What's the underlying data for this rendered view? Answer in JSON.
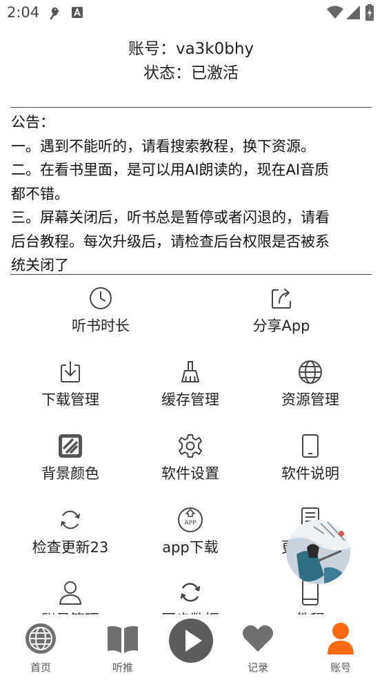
{
  "status_bar": {
    "time": "2:04"
  },
  "account": {
    "username_line": "账号：va3k0bhy",
    "status_line": "状态：已激活"
  },
  "notice": {
    "title": "公告：",
    "lines": [
      "一。遇到不能听的，请看搜索教程，换下资源。",
      "二。在看书里面，是可以用AI朗读的，现在AI音质",
      "都不错。",
      "三。屏幕关闭后，听书总是暂停或者闪退的，请看",
      "后台教程。每次升级后，请检查后台权限是否被系",
      "统关闭了"
    ]
  },
  "menu": {
    "listen_time": "听书时长",
    "share_app": "分享App",
    "download_manage": "下载管理",
    "cache_manage": "缓存管理",
    "source_manage": "资源管理",
    "bg_color": "背景颜色",
    "software_settings": "软件设置",
    "software_info": "软件说明",
    "check_update": "检查更新23",
    "app_download": "app下载",
    "update_log": "更新日志",
    "account_manage": "账号管理",
    "sync_data": "同步数据",
    "tutorial": "教程",
    "app_badge": "APP"
  },
  "bottom_nav": {
    "home": "首页",
    "recommend": "听推",
    "records": "记录",
    "account": "账号",
    "active_color": "#ff6a13",
    "inactive_color": "#6f6f6f"
  }
}
